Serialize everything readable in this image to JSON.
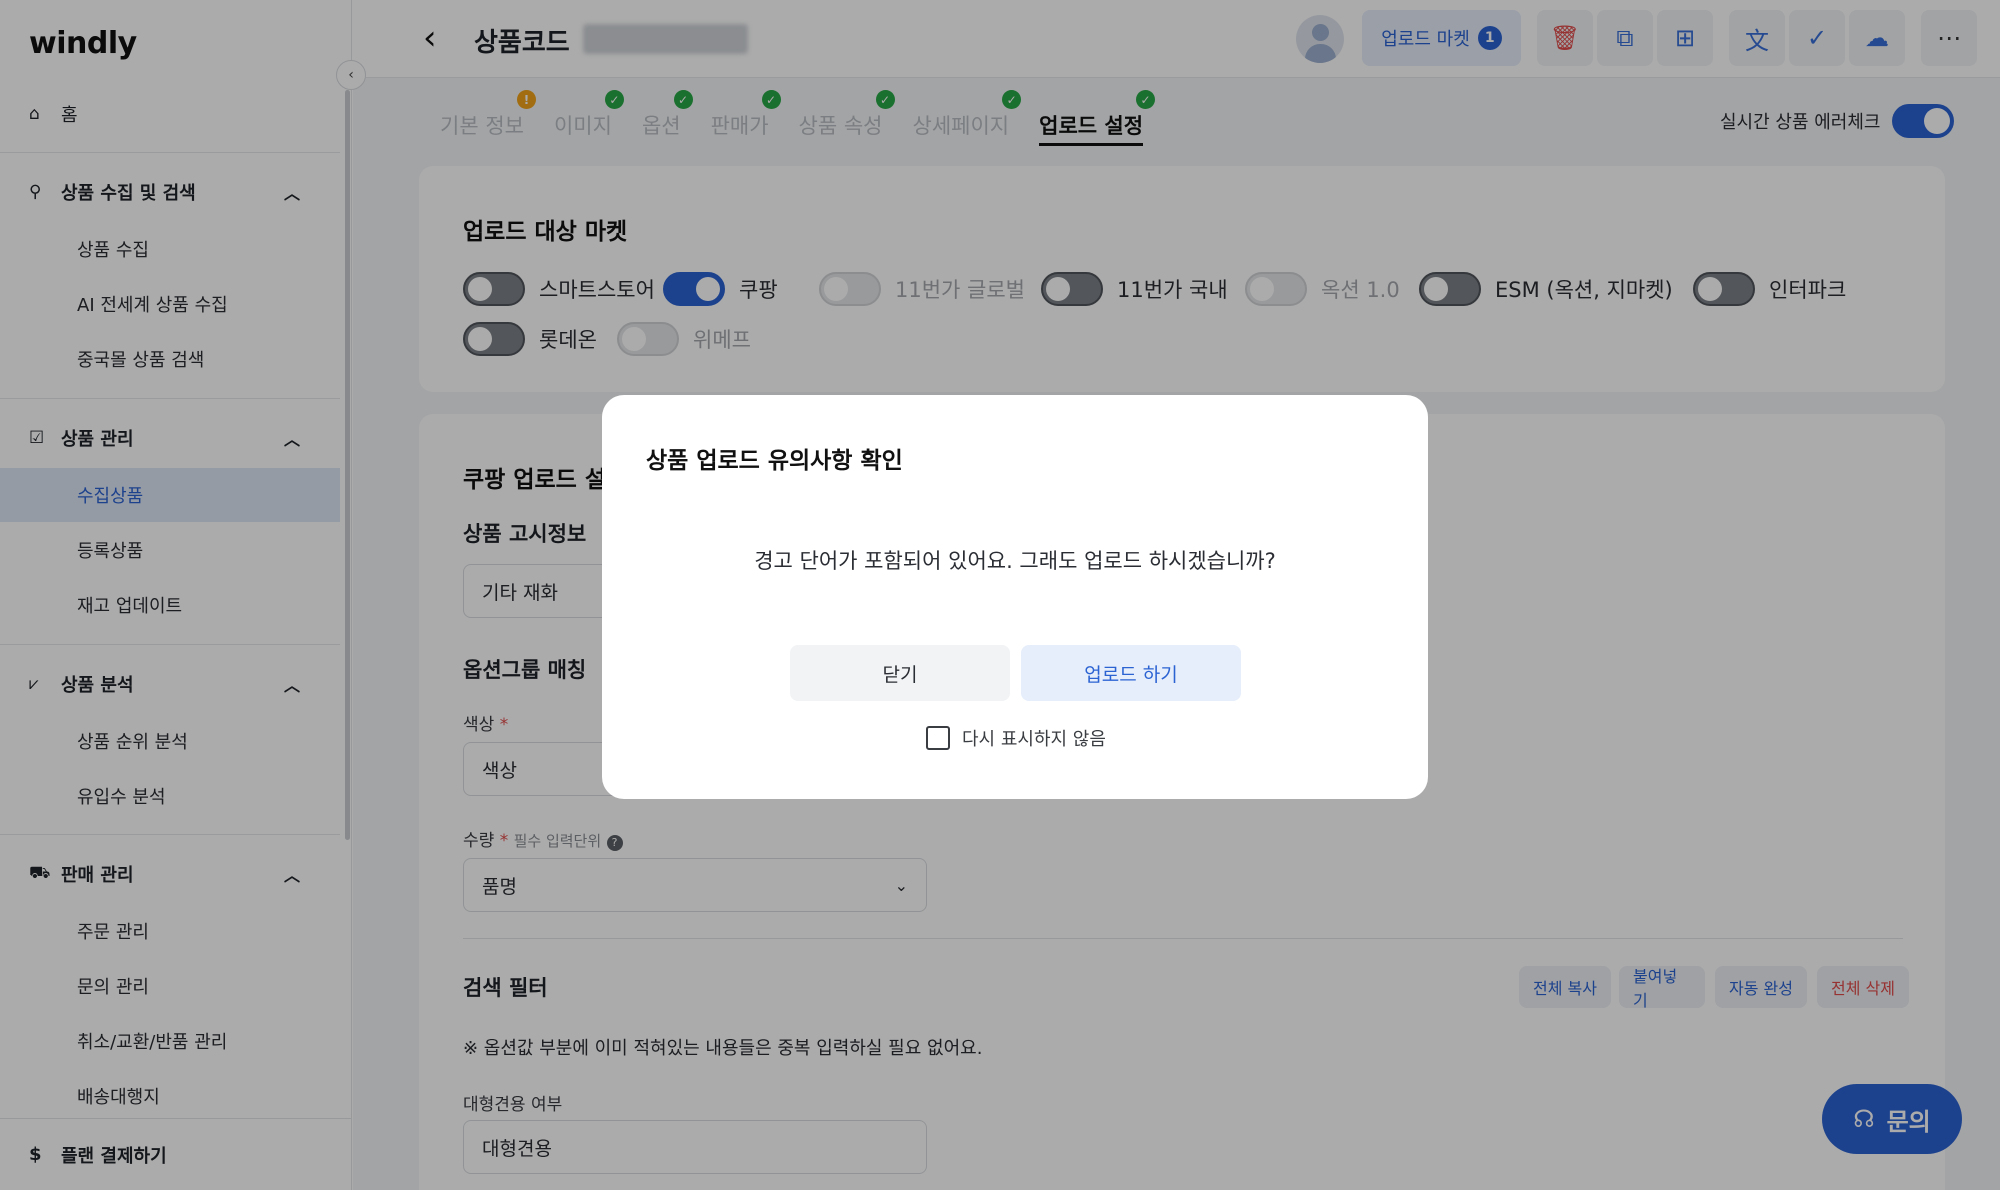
{
  "sidebar": {
    "logo": "windly",
    "home": "홈",
    "sections": [
      {
        "label": "상품 수집 및 검색",
        "items": [
          "상품 수집",
          "AI 전세계 상품 수집",
          "중국몰 상품 검색"
        ]
      },
      {
        "label": "상품 관리",
        "items": [
          "수집상품",
          "등록상품",
          "재고 업데이트"
        ]
      },
      {
        "label": "상품 분석",
        "items": [
          "상품 순위 분석",
          "유입수 분석"
        ]
      },
      {
        "label": "판매 관리",
        "items": [
          "주문 관리",
          "문의 관리",
          "취소/교환/반품 관리",
          "배송대행지"
        ]
      }
    ],
    "bottom": "플랜 결제하기",
    "active_item": "수집상품"
  },
  "header": {
    "title": "상품코드",
    "upload_market_label": "업로드 마켓",
    "upload_market_count": "1"
  },
  "tabs": [
    {
      "label": "기본 정보",
      "status": "warn"
    },
    {
      "label": "이미지",
      "status": "ok"
    },
    {
      "label": "옵션",
      "status": "ok"
    },
    {
      "label": "판매가",
      "status": "ok"
    },
    {
      "label": "상품 속성",
      "status": "ok"
    },
    {
      "label": "상세페이지",
      "status": "ok"
    },
    {
      "label": "업로드 설정",
      "status": "ok",
      "active": true
    }
  ],
  "realtime_check_label": "실시간 상품 에러체크",
  "upload_markets": {
    "title": "업로드 대상 마켓",
    "markets": [
      {
        "label": "스마트스토어",
        "state": "off"
      },
      {
        "label": "쿠팡",
        "state": "on"
      },
      {
        "label": "11번가 글로벌",
        "state": "disabled"
      },
      {
        "label": "11번가 국내",
        "state": "off"
      },
      {
        "label": "옥션 1.0",
        "state": "disabled"
      },
      {
        "label": "ESM (옥션, 지마켓)",
        "state": "off"
      },
      {
        "label": "인터파크",
        "state": "off"
      },
      {
        "label": "롯데온",
        "state": "off"
      },
      {
        "label": "위메프",
        "state": "disabled"
      }
    ]
  },
  "coupang": {
    "title": "쿠팡 업로드 설",
    "notice_title": "상품 고시정보",
    "notice_value": "기타 재화",
    "option_group_title": "옵션그룹 매칭",
    "color_label": "색상",
    "color_value": "색상",
    "qty_label": "수량",
    "qty_hint": "필수 입력단위",
    "qty_value": "품명",
    "filter_title": "검색 필터",
    "filter_buttons": [
      "전체 복사",
      "붙여넣기",
      "자동 완성",
      "전체 삭제"
    ],
    "filter_note": "※ 옵션값 부분에 이미 적혀있는 내용들은 중복 입력하실 필요 없어요.",
    "large_label": "대형견용 여부",
    "large_value": "대형견용"
  },
  "help_button": "문의",
  "modal": {
    "title": "상품 업로드 유의사항 확인",
    "message": "경고 단어가 포함되어 있어요. 그래도 업로드 하시겠습니까?",
    "close_label": "닫기",
    "upload_label": "업로드 하기",
    "dont_show_label": "다시 표시하지 않음"
  },
  "colors": {
    "accent": "#2c63d3",
    "danger": "#e24b4b",
    "ok": "#28a745",
    "warn": "#f0a318"
  }
}
